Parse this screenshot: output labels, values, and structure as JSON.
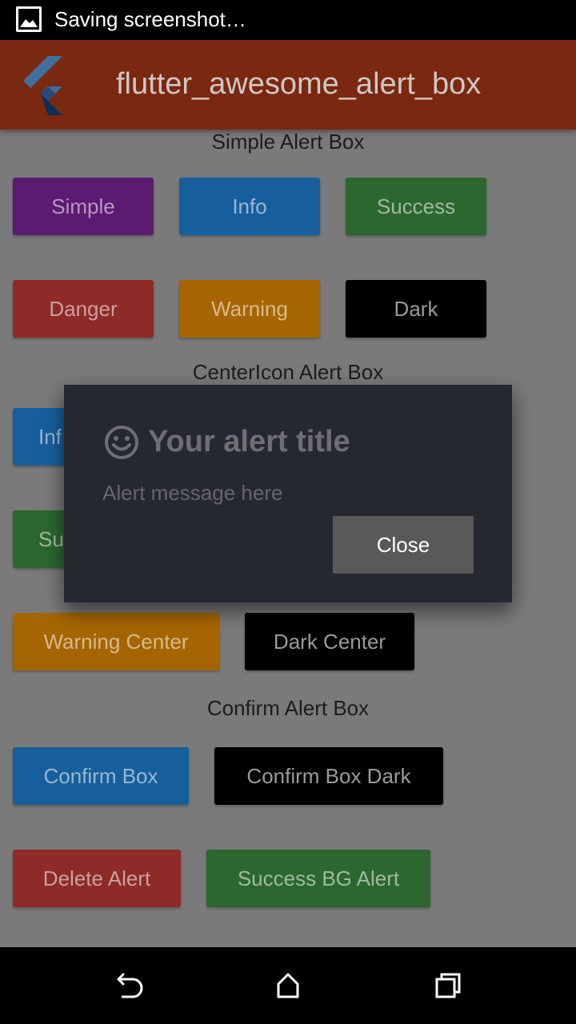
{
  "status_bar": {
    "notification_text": "Saving screenshot…",
    "notification_icon": "image-icon"
  },
  "app_bar": {
    "title": "flutter_awesome_alert_box",
    "logo": "flutter-logo"
  },
  "sections": {
    "simple": {
      "title": "Simple Alert Box",
      "buttons": [
        "Simple",
        "Info",
        "Success",
        "Danger",
        "Warning",
        "Dark"
      ]
    },
    "center_icon": {
      "title": "CenterIcon Alert Box",
      "buttons": [
        "Inf",
        "Su",
        "Warning Center",
        "Dark Center"
      ]
    },
    "confirm": {
      "title": "Confirm Alert Box",
      "buttons": [
        "Confirm Box",
        "Confirm Box Dark",
        "Delete Alert",
        "Success BG Alert"
      ]
    }
  },
  "dialog": {
    "icon": "smiley-face-icon",
    "title": "Your alert title",
    "message": "Alert message here",
    "close_label": "Close"
  },
  "nav_bar": {
    "back_icon": "back-icon",
    "home_icon": "home-icon",
    "recents_icon": "recents-icon"
  },
  "colors": {
    "app_bar": "#7a2810",
    "purple": "#5c1a71",
    "blue": "#175f9c",
    "green": "#2b672e",
    "red": "#8e2a27",
    "orange": "#a66500",
    "dark": "#000000",
    "dialog_bg": "#262830",
    "scrim_bg": "#7a7a7a"
  }
}
